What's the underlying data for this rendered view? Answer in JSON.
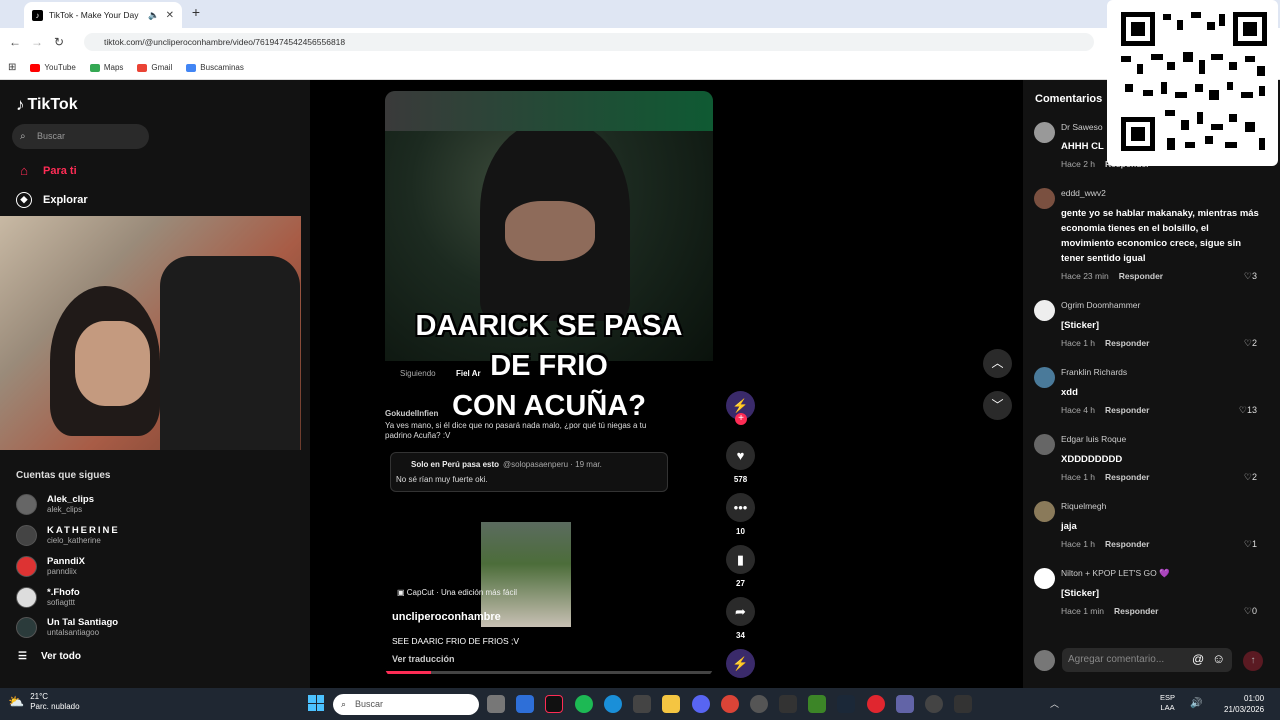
{
  "browser": {
    "tab_title": "TikTok - Make Your Day",
    "url": "tiktok.com/@uncliperoconhambre/video/7619474542456556818",
    "bookmarks": [
      {
        "label": "YouTube",
        "color": "#ff0000"
      },
      {
        "label": "Maps",
        "color": "#34a853"
      },
      {
        "label": "Gmail",
        "color": "#ea4335"
      },
      {
        "label": "Buscaminas",
        "color": "#4285f4"
      }
    ]
  },
  "sidebar": {
    "logo": "TikTok",
    "search_placeholder": "Buscar",
    "nav": [
      {
        "label": "Para ti",
        "icon": "home-icon",
        "active": true
      },
      {
        "label": "Explorar",
        "icon": "compass-icon",
        "active": false
      }
    ],
    "following_title": "Cuentas que sigues",
    "following": [
      {
        "name": "Alek_clips",
        "handle": "alek_clips"
      },
      {
        "name": "KATHERINE",
        "handle": "cielo_katherine"
      },
      {
        "name": "PanndiX",
        "handle": "panndiix"
      },
      {
        "name": "*.Fhofo",
        "handle": "sofiagttt"
      },
      {
        "name": "Un Tal Santiago",
        "handle": "untalsantiagoo"
      }
    ],
    "see_all": "Ver todo"
  },
  "video": {
    "caption_lines": [
      "DAARICK SE PASA",
      "DE FRIO",
      "CON ACUÑA?"
    ],
    "tabs": [
      "Siguiendo",
      "Fiel Ar"
    ],
    "post_user": "GokudelInfien",
    "post_text": "Ya ves mano, si él dice que no pasará nada malo, ¿por qué tú niegas a tu padrino Acuña? :V",
    "quote_user": "Solo en Perú pasa esto",
    "quote_handle": "@solopasaenperu · 19 mar.",
    "quote_text": "No sé rían muy fuerte oki.",
    "capcut": "CapCut · Una edición más fácil",
    "author": "uncliperoconhambre",
    "description": "SEE DAARIC FRIO DE FRIOS ;V",
    "translate": "Ver traducción",
    "progress": 0.14
  },
  "actions": {
    "likes": "578",
    "comments": "10",
    "saves": "27",
    "shares": "34"
  },
  "comments_panel": {
    "title": "Comentarios",
    "items": [
      {
        "user": "Dr Saweso",
        "text": "AHHH CL",
        "time": "Hace 2 h",
        "reply": "Responder",
        "likes": ""
      },
      {
        "user": "eddd_wwv2",
        "text": "gente yo se hablar makanaky, mientras más economia tienes en el bolsillo, el movimiento economico crece, sigue sin tener sentido igual",
        "time": "Hace 23 min",
        "reply": "Responder",
        "likes": "3"
      },
      {
        "user": "Ogrim Doomhammer",
        "text": "[Sticker]",
        "time": "Hace 1 h",
        "reply": "Responder",
        "likes": "2"
      },
      {
        "user": "Franklin Richards",
        "text": "xdd",
        "time": "Hace 4 h",
        "reply": "Responder",
        "likes": "13"
      },
      {
        "user": "Edgar luis Roque",
        "text": "XDDDDDDDD",
        "time": "Hace 1 h",
        "reply": "Responder",
        "likes": "2"
      },
      {
        "user": "Riquelmegh",
        "text": "jaja",
        "time": "Hace 1 h",
        "reply": "Responder",
        "likes": "1"
      },
      {
        "user": "Nilton + KPOP LET'S GO 💜",
        "text": "[Sticker]",
        "time": "Hace 1 min",
        "reply": "Responder",
        "likes": "0"
      }
    ],
    "input_placeholder": "Agregar comentario..."
  },
  "taskbar": {
    "temp": "21°C",
    "weather": "Parc. nublado",
    "search": "Buscar",
    "lang1": "ESP",
    "lang2": "LAA",
    "time": "01:00",
    "date": "21/03/2026"
  }
}
